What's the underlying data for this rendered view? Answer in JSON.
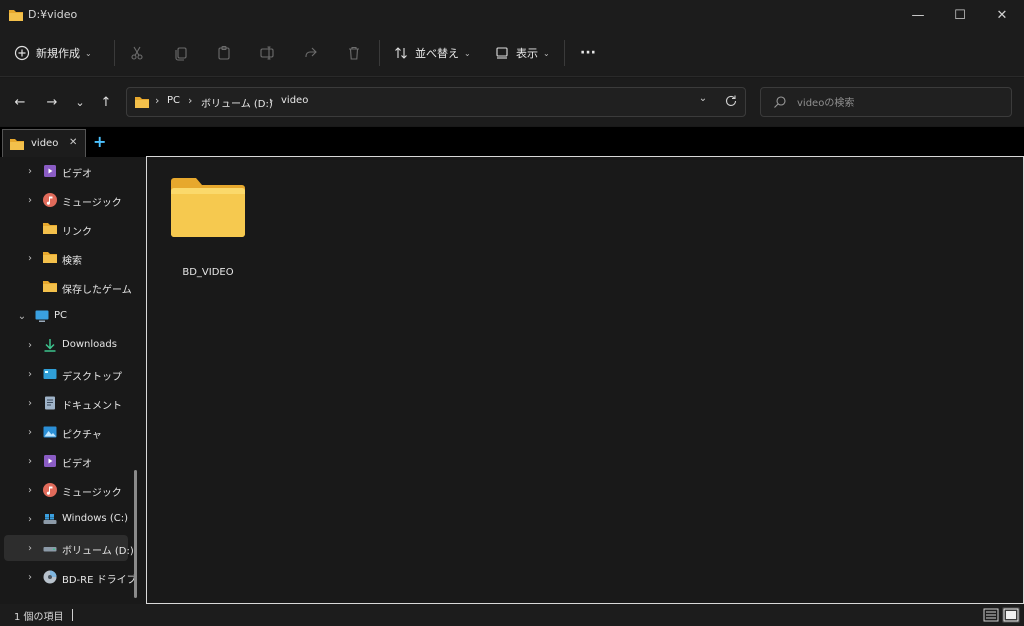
{
  "window": {
    "title": "D:¥video",
    "controls": {
      "minimize": "—",
      "maximize": "☐",
      "close": "✕"
    }
  },
  "toolbar": {
    "new_label": "新規作成",
    "sort_label": "並べ替え",
    "view_label": "表示",
    "more_label": "···"
  },
  "nav": {
    "back": "←",
    "forward": "→",
    "recent": "⌄",
    "up": "↑"
  },
  "address": {
    "breadcrumbs": [
      "PC",
      "ボリューム (D:)",
      "video"
    ],
    "separator": "›"
  },
  "search": {
    "placeholder": "videoの検索"
  },
  "tabs": [
    {
      "label": "video",
      "close": "✕"
    }
  ],
  "new_tab": "+",
  "sidebar": {
    "items": [
      {
        "label": "ビデオ",
        "icon": "video-icon",
        "chevron": "›"
      },
      {
        "label": "ミュージック",
        "icon": "music-icon",
        "chevron": "›"
      },
      {
        "label": "リンク",
        "icon": "folder-icon",
        "chevron": ""
      },
      {
        "label": "検索",
        "icon": "folder-icon",
        "chevron": "›"
      },
      {
        "label": "保存したゲーム",
        "icon": "folder-icon",
        "chevron": ""
      },
      {
        "label": "PC",
        "icon": "pc-icon",
        "chevron": "⌄"
      },
      {
        "label": "Downloads",
        "icon": "download-icon",
        "chevron": "›"
      },
      {
        "label": "デスクトップ",
        "icon": "desktop-icon",
        "chevron": "›"
      },
      {
        "label": "ドキュメント",
        "icon": "document-icon",
        "chevron": "›"
      },
      {
        "label": "ピクチャ",
        "icon": "picture-icon",
        "chevron": "›"
      },
      {
        "label": "ビデオ",
        "icon": "video-icon",
        "chevron": "›"
      },
      {
        "label": "ミュージック",
        "icon": "music-icon",
        "chevron": "›"
      },
      {
        "label": "Windows (C:)",
        "icon": "windows-drive-icon",
        "chevron": "›"
      },
      {
        "label": "ボリューム (D:)",
        "icon": "drive-icon",
        "chevron": "›"
      },
      {
        "label": "BD-RE ドライブ",
        "icon": "disc-drive-icon",
        "chevron": "›"
      }
    ]
  },
  "content": {
    "items": [
      {
        "name": "BD_VIDEO",
        "icon": "folder-icon"
      }
    ]
  },
  "status": {
    "text": "1 個の項目"
  },
  "colors": {
    "folder": "#f3c04b",
    "folder_dark": "#e7a82d",
    "accent": "#4cc2ff",
    "background": "#191919",
    "toolbar": "#1c1c1c"
  }
}
